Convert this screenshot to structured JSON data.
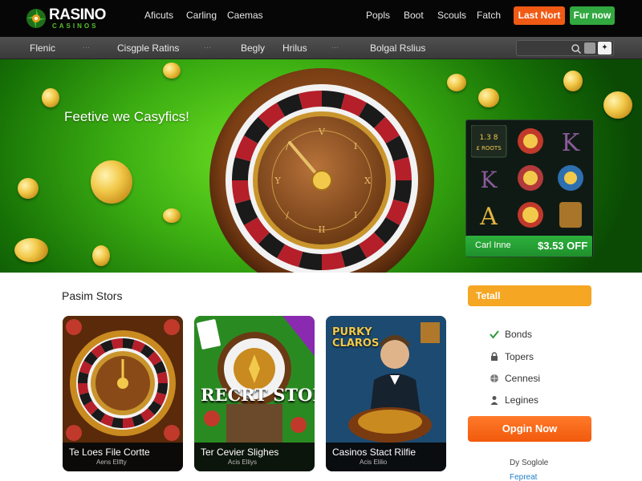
{
  "brand": {
    "name": "RASINO",
    "tagline": "CASINOS"
  },
  "nav": {
    "left": [
      "Aficuts",
      "Carling",
      "Caemas"
    ],
    "right": [
      "Popls",
      "Boot",
      "Scouls",
      "Fatch"
    ]
  },
  "buttons": {
    "primary": "Last Nort",
    "secondary": "Fur now"
  },
  "subnav": {
    "items": [
      "Flenic",
      "Cisgple Ratins",
      "Begly",
      "Hrilus",
      "Bolgal Rslius"
    ],
    "separator": "⋯"
  },
  "search": {
    "go": "✦"
  },
  "hero": {
    "title": "Feetive we Casyfics!",
    "offer": {
      "label": "Carl Inne",
      "value": "$3.53 OFF"
    },
    "slot_symbols": [
      "1.3 8 £ ROOTS",
      "☀",
      "K",
      "K",
      "⚓",
      "●",
      "A",
      "◉",
      "♜"
    ]
  },
  "section": {
    "title": "Pasim Stors"
  },
  "cards": [
    {
      "title": "Te Loes File Cortte",
      "subtitle": "Aens Ellfty",
      "banner": ""
    },
    {
      "title": "Ter Cevier Slighes",
      "subtitle": "Acis Elliys",
      "banner": "RECRT STOP"
    },
    {
      "title": "Casinos Stact Rilfie",
      "subtitle": "Acis Elilio",
      "banner": "PURKY CLAROS"
    }
  ],
  "sidebar": {
    "header": "Tetall",
    "items": [
      {
        "label": "Bonds",
        "icon": "check-icon"
      },
      {
        "label": "Topers",
        "icon": "lock-icon"
      },
      {
        "label": "Cennesi",
        "icon": "globe-icon"
      },
      {
        "label": "Legines",
        "icon": "user-icon"
      }
    ],
    "cta": "Opgin Now",
    "footer": [
      "Dy Soglole",
      "Fepreat"
    ]
  },
  "colors": {
    "accent_orange": "#f05a14",
    "accent_green": "#32a840",
    "sidebar_header": "#f5a623"
  }
}
